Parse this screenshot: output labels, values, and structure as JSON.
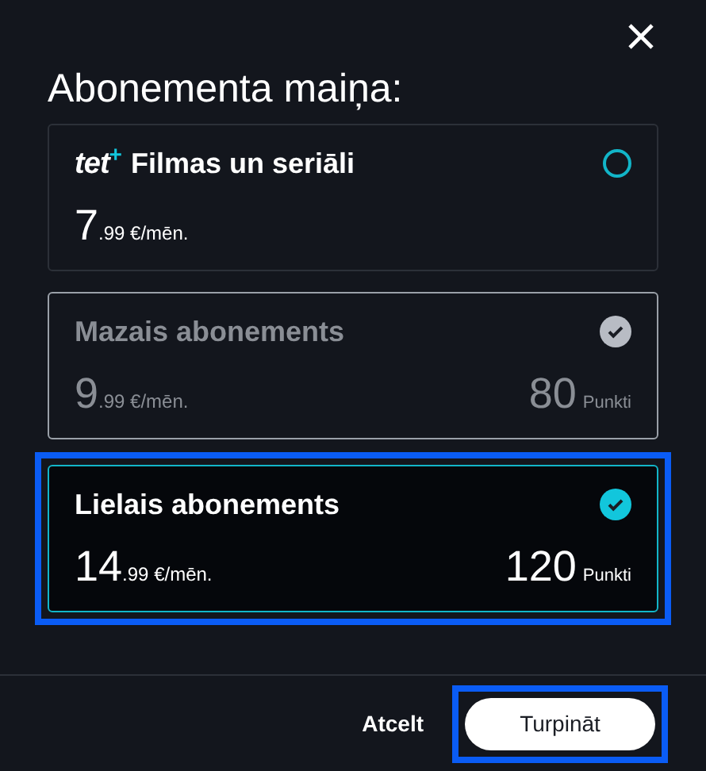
{
  "dialog": {
    "title": "Abonementa maiņa:"
  },
  "plans": [
    {
      "logo": {
        "text": "tet",
        "mark": "+"
      },
      "name": "Filmas un seriāli",
      "price_main": "7",
      "price_rest": ".99 €/mēn.",
      "current": false,
      "selected": false,
      "highlighted": false
    },
    {
      "name": "Mazais abonements",
      "price_main": "9",
      "price_rest": ".99 €/mēn.",
      "points": "80",
      "points_label": "Punkti",
      "current": true,
      "selected": false,
      "highlighted": false
    },
    {
      "name": "Lielais abonements",
      "price_main": "14",
      "price_rest": ".99 €/mēn.",
      "points": "120",
      "points_label": "Punkti",
      "current": false,
      "selected": true,
      "highlighted": true
    }
  ],
  "footer": {
    "cancel": "Atcelt",
    "continue": {
      "label": "Turpināt",
      "highlighted": true
    }
  }
}
